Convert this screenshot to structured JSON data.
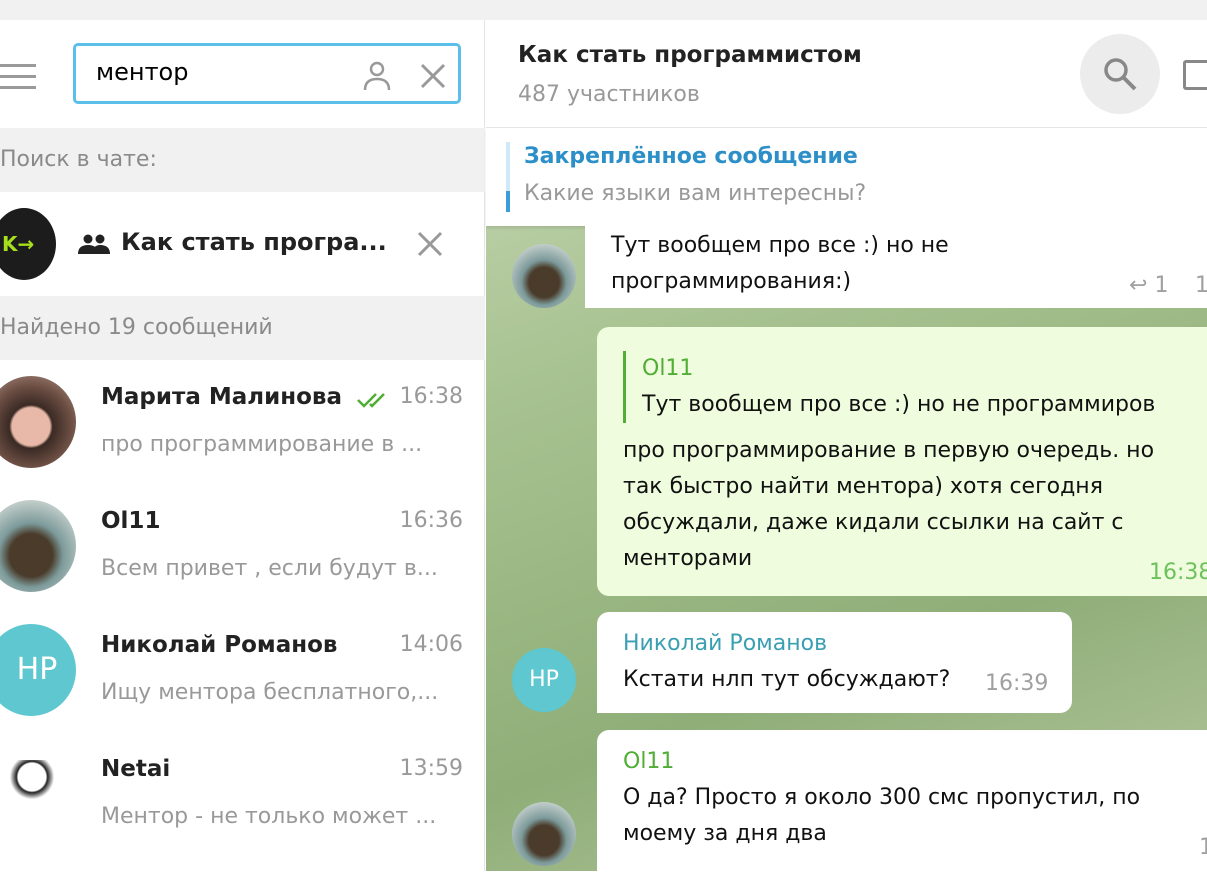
{
  "search": {
    "value": "ментор"
  },
  "left": {
    "search_in_chat_label": "Поиск в чате:",
    "chat_name": "Как стать програ...",
    "found_label": "Найдено 19 сообщений",
    "results": [
      {
        "name": "Марита Малинова",
        "time": "16:38",
        "snippet": "про программирование в ...",
        "read": true
      },
      {
        "name": "Ol11",
        "time": "16:36",
        "snippet": "Всем привет , если будут в..."
      },
      {
        "name": "Николай Романов",
        "time": "14:06",
        "snippet": "Ищу ментора бесплатного,...",
        "initials": "НР"
      },
      {
        "name": "Netai",
        "time": "13:59",
        "snippet": "Ментор - не только может ..."
      }
    ]
  },
  "chat": {
    "title": "Как стать программистом",
    "members": "487 участников",
    "pinned_label": "Закреплённое сообщение",
    "pinned_text": "Какие языки вам интересны?",
    "messages": [
      {
        "lines": [
          "Тут вообщем про все :) но не",
          "программирования:)"
        ],
        "replies": "1",
        "time": "1"
      },
      {
        "reply_author": "Ol11",
        "reply_text": "Тут вообщем про все :) но не программиров",
        "lines": [
          "про программирование в первую очередь. но",
          "так быстро найти ментора) хотя сегодня",
          "обсуждали, даже кидали ссылки на сайт с",
          "менторами"
        ],
        "time": "16:38"
      },
      {
        "author": "Николай Романов",
        "initials": "НР",
        "lines": [
          "Кстати нлп тут обсуждают?"
        ],
        "time": "16:39"
      },
      {
        "author": "Ol11",
        "lines": [
          "О да? Просто я около 300 смс пропустил, по",
          "моему за дня два"
        ],
        "time": "1"
      }
    ]
  },
  "colors": {
    "accent": "#5bbfe9",
    "green": "#4fae33",
    "teal": "#3a9fb0"
  }
}
